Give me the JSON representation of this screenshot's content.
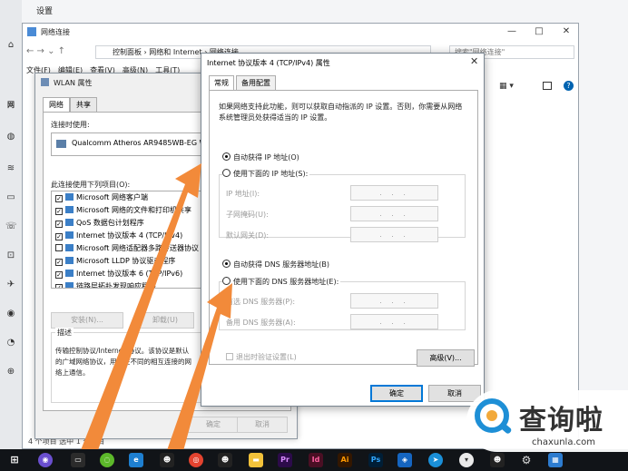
{
  "settings": {
    "title": "设置"
  },
  "network_window": {
    "title": "网络连接",
    "breadcrumb": "控制面板 › 网络和 Internet › 网络连接",
    "search_placeholder": "搜索\"网络连接\"",
    "menu": [
      "文件(F)",
      "编辑(E)",
      "查看(V)",
      "高级(N)",
      "工具(T)"
    ],
    "status": "4 个项目    选中 1 个项目"
  },
  "wlan_dialog": {
    "title": "WLAN 属性",
    "tabs": [
      "网络",
      "共享"
    ],
    "connect_using_label": "连接时使用:",
    "adapter": "Qualcomm Atheros AR9485WB-EG W",
    "items_label": "此连接使用下列项目(O):",
    "items": [
      {
        "label": "Microsoft 网络客户端",
        "checked": true
      },
      {
        "label": "Microsoft 网络的文件和打印机共享",
        "checked": true
      },
      {
        "label": "QoS 数据包计划程序",
        "checked": true
      },
      {
        "label": "Internet 协议版本 4 (TCP/IPv4)",
        "checked": true
      },
      {
        "label": "Microsoft 网络适配器多路传送器协议",
        "checked": false
      },
      {
        "label": "Microsoft LLDP 协议驱动程序",
        "checked": true
      },
      {
        "label": "Internet 协议版本 6 (TCP/IPv6)",
        "checked": true
      },
      {
        "label": "链路层拓扑发现响应程序",
        "checked": true
      }
    ],
    "install_button": "安装(N)...",
    "uninstall_button": "卸载(U)",
    "description_label": "描述",
    "description_text": "传输控制协议/Internet 协议。该协议是默认的广域网络协议，用于在不同的相互连接的网络上通信。",
    "ok_button": "确定",
    "cancel_button": "取消"
  },
  "ipv4_dialog": {
    "title": "Internet 协议版本 4 (TCP/IPv4) 属性",
    "tabs": [
      "常规",
      "备用配置"
    ],
    "intro": "如果网络支持此功能，则可以获取自动指派的 IP 设置。否则，你需要从网络系统管理员处获得适当的 IP 设置。",
    "auto_ip": "自动获得 IP 地址(O)",
    "manual_ip": "使用下面的 IP 地址(S):",
    "ip_address_label": "IP 地址(I):",
    "subnet_label": "子网掩码(U):",
    "gateway_label": "默认网关(D):",
    "auto_dns": "自动获得 DNS 服务器地址(B)",
    "manual_dns": "使用下面的 DNS 服务器地址(E):",
    "preferred_dns_label": "首选 DNS 服务器(P):",
    "alternate_dns_label": "备用 DNS 服务器(A):",
    "empty_ip": ".   .   .",
    "validate_label": "退出时验证设置(L)",
    "advanced_button": "高级(V)...",
    "ok_button": "确定",
    "cancel_button": "取消"
  },
  "watermark": {
    "cn": "查询啦",
    "en": "chaxunla.com"
  },
  "colors": {
    "arrow": "#f28a3a",
    "watermark_blue": "#1e8fd6",
    "taskbar": "#111418"
  }
}
